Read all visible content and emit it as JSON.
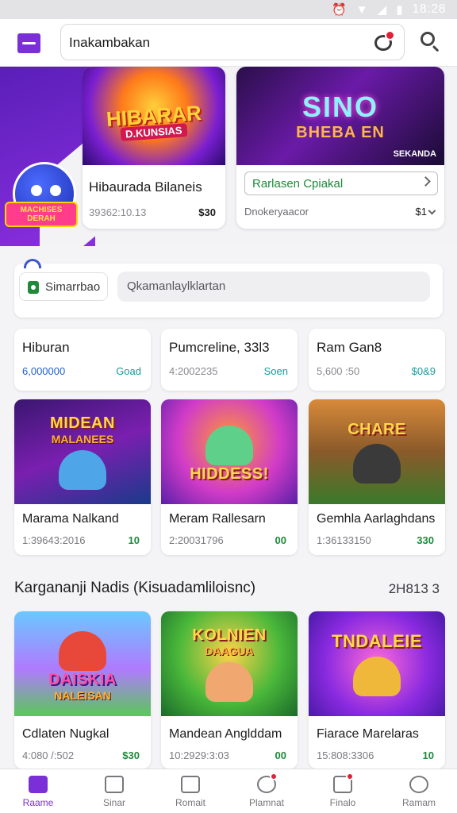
{
  "status_bar": {
    "time": "18:28"
  },
  "header": {
    "search_value": "Inakambakan"
  },
  "promo": {
    "mascot_label": "MACHISES DERAH",
    "card_a": {
      "art_title": "HIBARAR",
      "art_sub": "D.KUNSIAS",
      "title": "Hibaurada Bilaneis",
      "sub": "39362:10.13",
      "price": "$30"
    },
    "card_b": {
      "art_title": "SINO",
      "art_sub": "BHEBA EN",
      "art_tag": "SEKANDA",
      "button": "Rarlasen Cpiakal",
      "sub": "Dnokeryaacor",
      "price": "$1"
    }
  },
  "filter": {
    "chip": "Simarrbao",
    "input_value": "Qkamanlaylklartan"
  },
  "stats": [
    {
      "title": "Hiburan",
      "value": "6,000000",
      "link": "Goad"
    },
    {
      "title": "Pumcreline, 33l3",
      "value": "4:2002235",
      "link": "Soen"
    },
    {
      "title": "Ram Gan8",
      "value": "5,600 :50",
      "link": "$0&9"
    }
  ],
  "games_row1": [
    {
      "art_title": "MIDEAN",
      "art_sub": "MALANEES",
      "name": "Marama Nalkand",
      "meta": "1:39643:2016",
      "badge": "10"
    },
    {
      "art_title": "HIDDESS!",
      "art_sub": "",
      "name": "Meram Rallesarn",
      "meta": "2:20031796",
      "badge": "00"
    },
    {
      "art_title": "CHARE",
      "art_sub": "",
      "name": "Gemhla Aarlaghdans",
      "meta": "1:36133150",
      "badge": "330"
    }
  ],
  "section": {
    "title": "Kargananji Nadis (Kisuadamliloisnc)",
    "count": "2H813 3"
  },
  "games_row2": [
    {
      "art_title": "DAISKIA",
      "art_sub": "NALEISAN",
      "name": "Cdlaten Nugkal",
      "meta": "4:080 /:502",
      "badge": "$30"
    },
    {
      "art_title": "KOLNIEN",
      "art_sub": "DAAGUA",
      "name": "Mandean Anglddam",
      "meta": "10:2929:3:03",
      "badge": "00"
    },
    {
      "art_title": "TNDALEIE",
      "art_sub": "",
      "name": "Fiarace Marelaras",
      "meta": "15:808:3306",
      "badge": "10"
    }
  ],
  "nav": [
    {
      "label": "Raame"
    },
    {
      "label": "Sinar"
    },
    {
      "label": "Romait"
    },
    {
      "label": "Plamnat"
    },
    {
      "label": "Finalo"
    },
    {
      "label": "Ramam"
    }
  ],
  "colors": {
    "accent": "#7b2fd6",
    "green": "#1e8a3a",
    "blue": "#1f5fd0",
    "badge_red": "#e0213a"
  }
}
